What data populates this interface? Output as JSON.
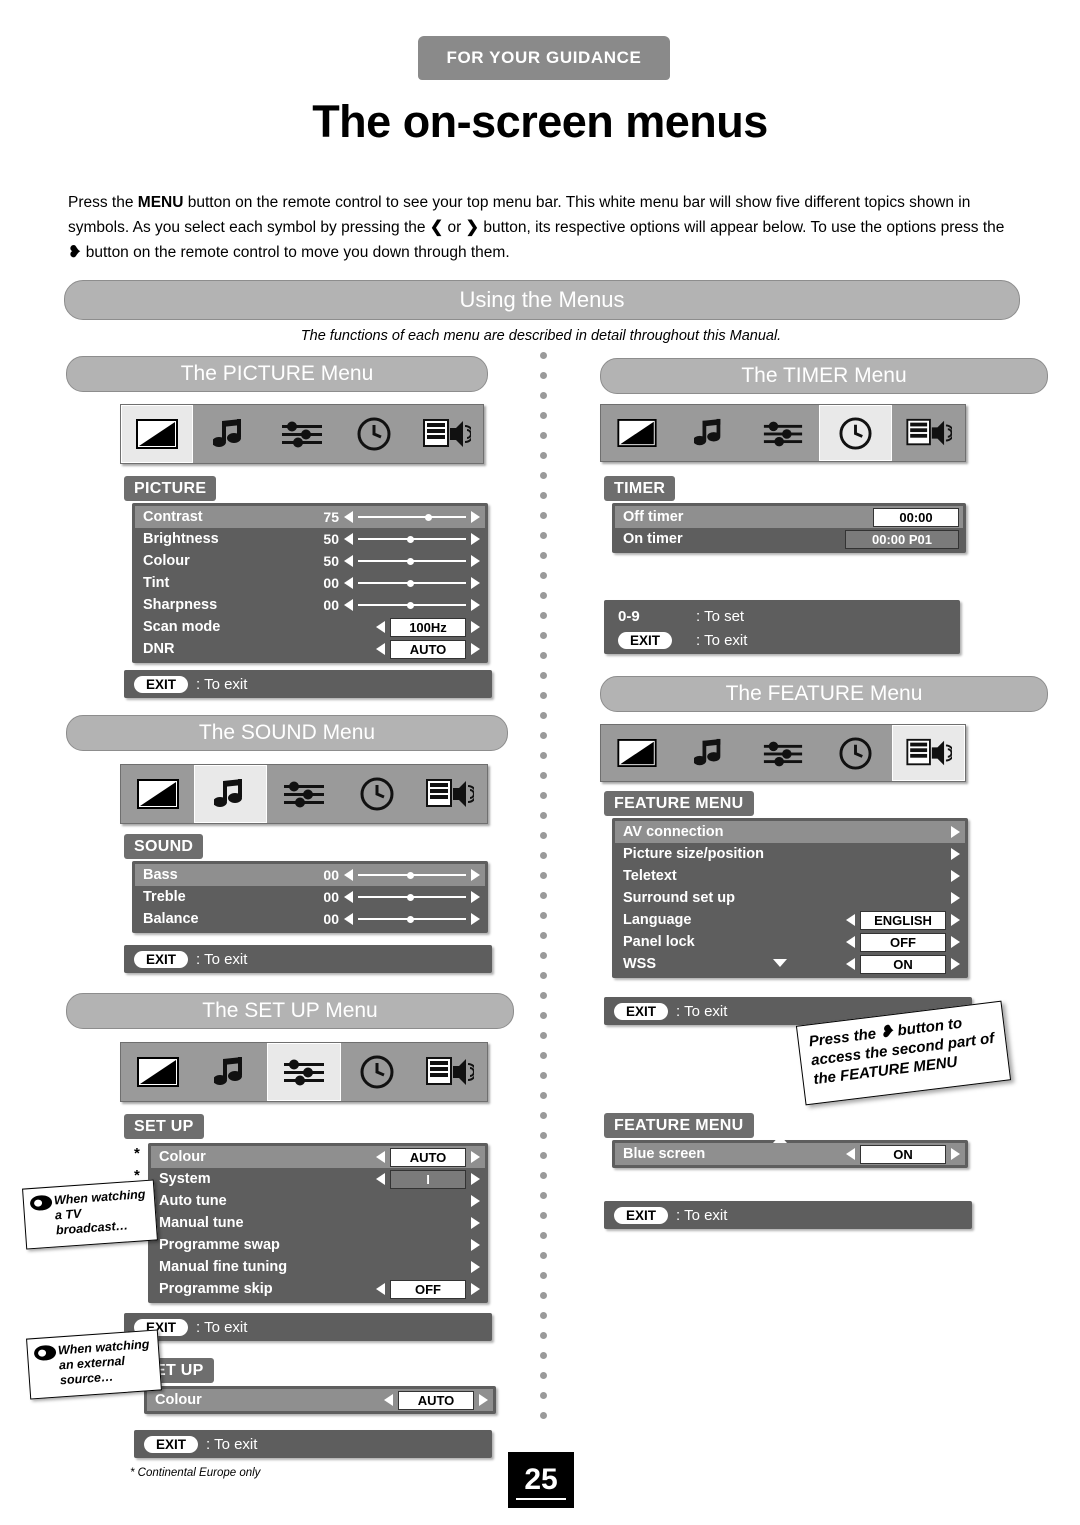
{
  "header": {
    "tab": "FOR YOUR GUIDANCE",
    "title": "The on-screen menus",
    "intro_1": "Press the ",
    "intro_menu": "MENU",
    "intro_2": " button on the remote control to see your top menu bar. This white menu bar will show five different topics shown in symbols. As you select each symbol by pressing the ",
    "intro_3": " or ",
    "intro_4": " button, its respective options will appear below. To use the options press the ",
    "intro_5": " button on the remote control to move you down through them."
  },
  "banner": {
    "title": "Using the Menus",
    "subtitle": "The functions of each menu are described in detail throughout this Manual."
  },
  "icons": [
    "picture-icon",
    "sound-icon",
    "setup-icon",
    "timer-icon",
    "feature-icon"
  ],
  "picture": {
    "pill": "The PICTURE Menu",
    "tag": "PICTURE",
    "rows": [
      {
        "label": "Contrast",
        "value": "75",
        "type": "slider",
        "pos": 62
      },
      {
        "label": "Brightness",
        "value": "50",
        "type": "slider",
        "pos": 45
      },
      {
        "label": "Colour",
        "value": "50",
        "type": "slider",
        "pos": 45
      },
      {
        "label": "Tint",
        "value": "00",
        "type": "slider",
        "pos": 45
      },
      {
        "label": "Sharpness",
        "value": "00",
        "type": "slider",
        "pos": 45
      },
      {
        "label": "Scan mode",
        "value": "100Hz",
        "type": "chip"
      },
      {
        "label": "DNR",
        "value": "AUTO",
        "type": "chip"
      }
    ],
    "exit": {
      "key": "EXIT",
      "text": ": To exit"
    }
  },
  "sound": {
    "pill": "The SOUND Menu",
    "tag": "SOUND",
    "rows": [
      {
        "label": "Bass",
        "value": "00",
        "type": "slider",
        "pos": 45
      },
      {
        "label": "Treble",
        "value": "00",
        "type": "slider",
        "pos": 45
      },
      {
        "label": "Balance",
        "value": "00",
        "type": "slider",
        "pos": 45
      }
    ],
    "exit": {
      "key": "EXIT",
      "text": ": To exit"
    }
  },
  "setup": {
    "pill": "The SET UP Menu",
    "tag": "SET UP",
    "rows": [
      {
        "label": "Colour",
        "value": "AUTO",
        "type": "chip",
        "star": true
      },
      {
        "label": "System",
        "value": "I",
        "type": "chipdark",
        "star": true
      },
      {
        "label": "Auto tune",
        "value": "",
        "type": "arrow"
      },
      {
        "label": "Manual tune",
        "value": "",
        "type": "arrow"
      },
      {
        "label": "Programme swap",
        "value": "",
        "type": "arrow"
      },
      {
        "label": "Manual fine tuning",
        "value": "",
        "type": "arrow"
      },
      {
        "label": "Programme skip",
        "value": "OFF",
        "type": "chip"
      }
    ],
    "exit": {
      "key": "EXIT",
      "text": ": To exit"
    },
    "tag2": "SET UP",
    "rows2": [
      {
        "label": "Colour",
        "value": "AUTO",
        "type": "chip"
      }
    ],
    "exit2": {
      "key": "EXIT",
      "text": ": To exit"
    },
    "callout1": "When watching a TV broadcast…",
    "callout2": "When watching an external source…"
  },
  "timer": {
    "pill": "The TIMER Menu",
    "tag": "TIMER",
    "rows": [
      {
        "label": "Off timer",
        "value": "00:00",
        "type": "chip",
        "hl": true
      },
      {
        "label": "On timer",
        "value": "00:00  P01",
        "type": "chipdark"
      }
    ],
    "set_rows": [
      {
        "key": "0-9",
        "text": ": To set",
        "pill": false
      },
      {
        "key": "EXIT",
        "text": ": To exit",
        "pill": true
      }
    ]
  },
  "feature": {
    "pill": "The FEATURE Menu",
    "tag": "FEATURE MENU",
    "rows": [
      {
        "label": "AV connection",
        "value": "",
        "type": "arrow",
        "hl": true
      },
      {
        "label": "Picture size/position",
        "value": "",
        "type": "arrow"
      },
      {
        "label": "Teletext",
        "value": "",
        "type": "arrow"
      },
      {
        "label": "Surround set up",
        "value": "",
        "type": "arrow"
      },
      {
        "label": "Language",
        "value": "ENGLISH",
        "type": "chip"
      },
      {
        "label": "Panel lock",
        "value": "OFF",
        "type": "chip"
      },
      {
        "label": "WSS",
        "value": "ON",
        "type": "chip"
      }
    ],
    "exit": {
      "key": "EXIT",
      "text": ": To exit"
    },
    "note": "Press the ❥ button to access the second part of the FEATURE MENU",
    "note_l1": "Press the",
    "note_l2": "button to",
    "note_l3": "access the second part",
    "note_l4": "of the FEATURE MENU",
    "tag2": "FEATURE MENU",
    "rows2": [
      {
        "label": "Blue screen",
        "value": "ON",
        "type": "chip",
        "hl": true
      }
    ],
    "exit2": {
      "key": "EXIT",
      "text": ": To exit"
    }
  },
  "footer": {
    "page": "25",
    "footnote": "* Continental Europe only"
  }
}
